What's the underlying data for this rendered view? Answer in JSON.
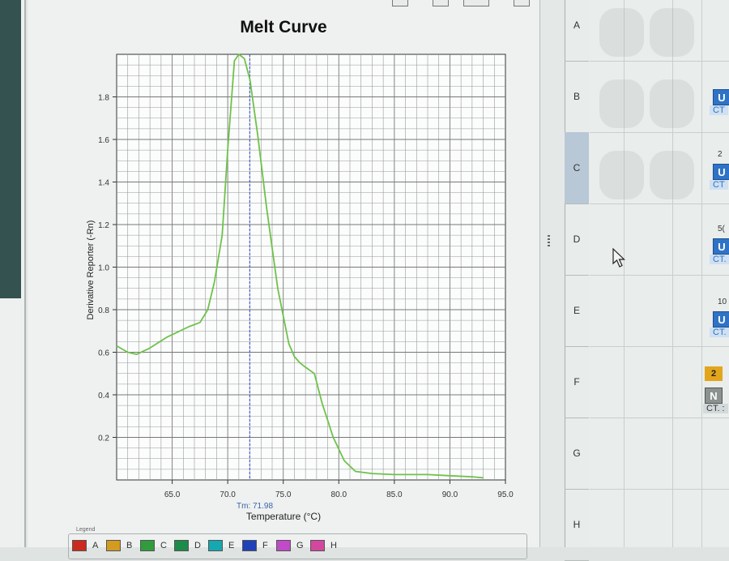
{
  "window": {
    "title": "Melt Curve"
  },
  "chart_data": {
    "type": "line",
    "title": "Melt Curve",
    "xlabel": "Temperature (°C)",
    "ylabel": "Derivative Reporter (-Rn)",
    "xlim": [
      60.0,
      95.0
    ],
    "ylim": [
      0.0,
      2.0
    ],
    "x_ticks": [
      "65.0",
      "70.0",
      "75.0",
      "80.0",
      "85.0",
      "90.0",
      "95.0"
    ],
    "y_ticks": [
      "0.2",
      "0.4",
      "0.6",
      "0.8",
      "1.0",
      "1.2",
      "1.4",
      "1.6",
      "1.8"
    ],
    "grid": true,
    "series": [
      {
        "color": "#6ec24a",
        "x": [
          60.0,
          61.0,
          61.8,
          63.0,
          64.5,
          66.5,
          67.5,
          68.2,
          68.8,
          69.5,
          70.0,
          70.6,
          71.0,
          71.5,
          72.0,
          72.7,
          73.5,
          74.5,
          75.5,
          76.0,
          76.5,
          77.0,
          77.8,
          78.5,
          79.5,
          80.5,
          81.5,
          83.0,
          85.0,
          88.0,
          90.0,
          92.0,
          93.0
        ],
        "values": [
          0.63,
          0.6,
          0.59,
          0.62,
          0.67,
          0.72,
          0.74,
          0.8,
          0.93,
          1.15,
          1.55,
          1.97,
          2.0,
          1.98,
          1.88,
          1.62,
          1.28,
          0.9,
          0.64,
          0.58,
          0.55,
          0.53,
          0.5,
          0.36,
          0.2,
          0.09,
          0.04,
          0.03,
          0.025,
          0.025,
          0.02,
          0.015,
          0.01
        ]
      }
    ],
    "tm_line": {
      "x": 71.98,
      "color": "#2d4fd6"
    },
    "annotation": "Tm: 71.98"
  },
  "legend": {
    "title": "Legend",
    "items": [
      {
        "label": "A",
        "color": "#cc2a1e"
      },
      {
        "label": "B",
        "color": "#d39b1f"
      },
      {
        "label": "C",
        "color": "#2f9d3c"
      },
      {
        "label": "D",
        "color": "#1d8b4a"
      },
      {
        "label": "E",
        "color": "#16a8b0"
      },
      {
        "label": "F",
        "color": "#2042b8"
      },
      {
        "label": "G",
        "color": "#c04ac8"
      },
      {
        "label": "H",
        "color": "#d3489e"
      }
    ]
  },
  "plate": {
    "rows": [
      "A",
      "B",
      "C",
      "D",
      "E",
      "F",
      "G",
      "H"
    ],
    "selected_row": "C",
    "wells": [
      {
        "badge": "U",
        "ct": "CT",
        "num": ""
      },
      {
        "badge": "U",
        "ct": "CT",
        "num": "2"
      },
      {
        "badge": "U",
        "ct": "CT.",
        "num": "5("
      },
      {
        "badge": "U",
        "ct": "CT.",
        "num": "10"
      }
    ],
    "warning_badge": "2",
    "ntc_badge": "N",
    "ntc_ct": "CT. :"
  }
}
